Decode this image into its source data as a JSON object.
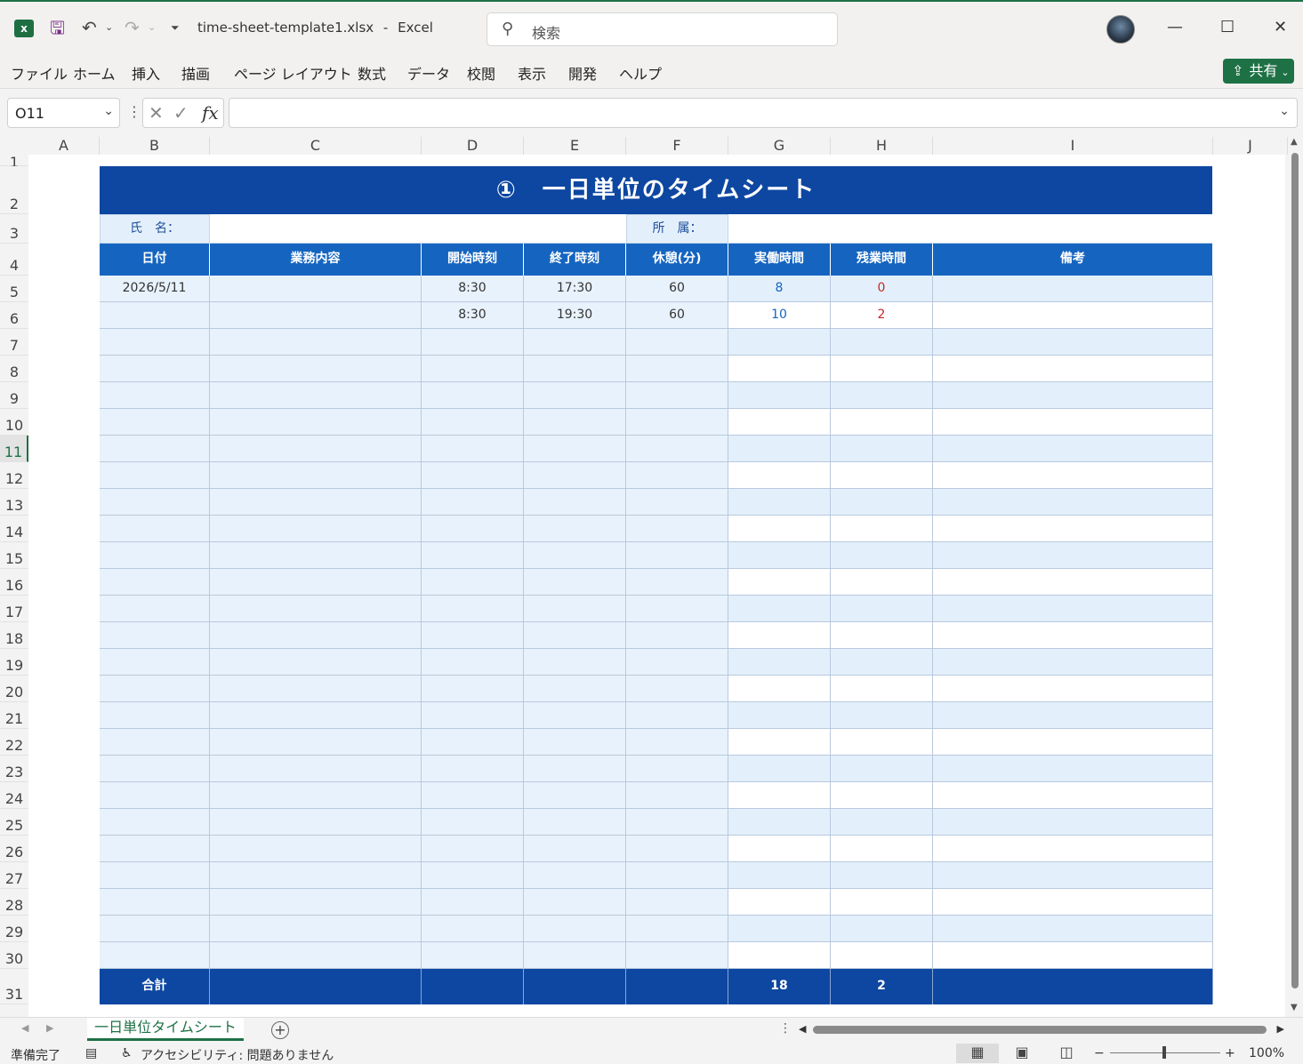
{
  "window": {
    "app_icon": "x",
    "filename": "time-sheet-template1.xlsx",
    "separator": "-",
    "app_name": "Excel",
    "search_placeholder": "検索"
  },
  "menu": [
    "ファイル",
    "ホーム",
    "挿入",
    "描画",
    "ページ レイアウト",
    "数式",
    "データ",
    "校閲",
    "表示",
    "開発",
    "ヘルプ"
  ],
  "share_label": "共有",
  "formula_bar": {
    "name_box": "O11",
    "fx_label": "fx",
    "formula": ""
  },
  "columns": [
    "A",
    "B",
    "C",
    "D",
    "E",
    "F",
    "G",
    "H",
    "I",
    "J"
  ],
  "rows": [
    "1",
    "2",
    "3",
    "4",
    "5",
    "6",
    "7",
    "8",
    "9",
    "10",
    "11",
    "12",
    "13",
    "14",
    "15",
    "16",
    "17",
    "18",
    "19",
    "20",
    "21",
    "22",
    "23",
    "24",
    "25",
    "26",
    "27",
    "28",
    "29",
    "30",
    "31"
  ],
  "active_row": "11",
  "sheet": {
    "title": "①　一日単位のタイムシート",
    "name_label": "氏　名：",
    "name_value": "",
    "dept_label": "所　属：",
    "dept_value": "",
    "headers": [
      "日付",
      "業務内容",
      "開始時刻",
      "終了時刻",
      "休憩(分)",
      "実働時間",
      "残業時間",
      "備考"
    ],
    "data_rows": [
      {
        "date": "2026/5/11",
        "task": "",
        "start": "8:30",
        "end": "17:30",
        "break": "60",
        "work": "8",
        "overtime": "0",
        "note": ""
      },
      {
        "date": "",
        "task": "",
        "start": "8:30",
        "end": "19:30",
        "break": "60",
        "work": "10",
        "overtime": "2",
        "note": ""
      }
    ],
    "empty_rows": 24,
    "total_label": "合計",
    "total_work": "18",
    "total_overtime": "2"
  },
  "tabs": {
    "active": "一日単位タイムシート"
  },
  "status": {
    "ready": "準備完了",
    "accessibility": "アクセシビリティ: 問題ありません",
    "zoom": "100%"
  },
  "colors": {
    "title_bg": "#0d47a1",
    "header_bg": "#1565c0",
    "accent_green": "#1e7145"
  }
}
